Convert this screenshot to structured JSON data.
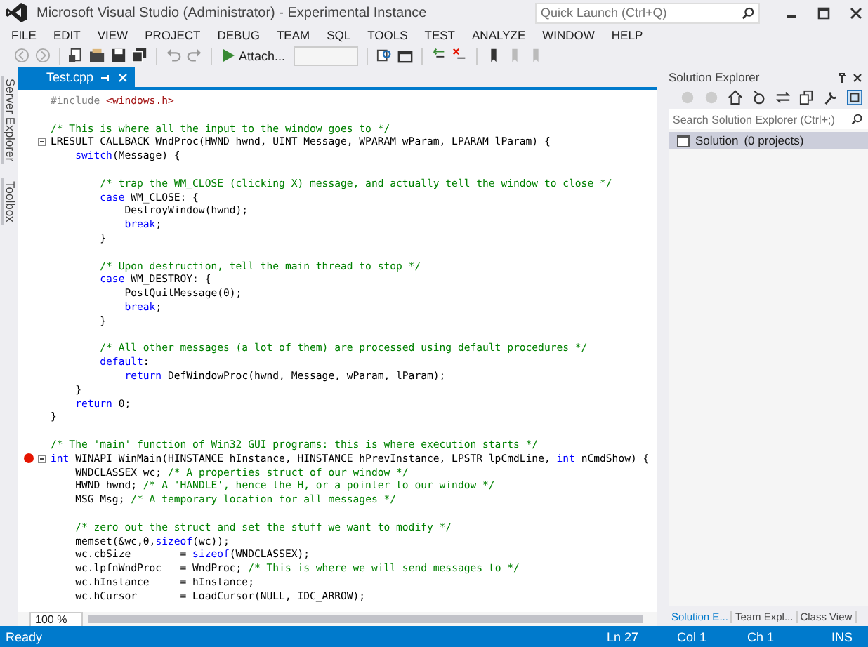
{
  "window": {
    "title": "Microsoft Visual Studio (Administrator) - Experimental Instance"
  },
  "quick_launch": {
    "placeholder": "Quick Launch (Ctrl+Q)"
  },
  "menu": [
    "FILE",
    "EDIT",
    "VIEW",
    "PROJECT",
    "DEBUG",
    "TEAM",
    "SQL",
    "TOOLS",
    "TEST",
    "ANALYZE",
    "WINDOW",
    "HELP"
  ],
  "toolbar": {
    "attach_button": "Attach..."
  },
  "side_tabs": [
    "Server Explorer",
    "Toolbox"
  ],
  "document_tabs": [
    {
      "label": "Test.cpp",
      "selected": true
    }
  ],
  "editor": {
    "zoom": "100 %",
    "lines": [
      {
        "breakpoint": false,
        "fold": false,
        "segments": [
          {
            "kind": "preproc",
            "text": "#include "
          },
          {
            "kind": "string",
            "text": "<windows.h>"
          }
        ]
      },
      {
        "breakpoint": false,
        "fold": false
      },
      {
        "breakpoint": false,
        "fold": false,
        "segments": [
          {
            "kind": "comment",
            "text": "/* This is where all the input to the window goes to */"
          }
        ]
      },
      {
        "breakpoint": false,
        "fold": true,
        "segments": [
          {
            "kind": "plain",
            "text": "LRESULT CALLBACK WndProc(HWND hwnd, UINT Message, WPARAM wParam, LPARAM lParam) {"
          }
        ]
      },
      {
        "breakpoint": false,
        "fold": false,
        "segments": [
          {
            "kind": "keyword",
            "text": "    switch"
          },
          {
            "kind": "plain",
            "text": "(Message) {"
          }
        ]
      },
      {
        "breakpoint": false,
        "fold": false
      },
      {
        "breakpoint": false,
        "fold": false,
        "segments": [
          {
            "kind": "comment",
            "text": "        /* trap the WM_CLOSE (clicking X) message, and actually tell the window to close */"
          }
        ]
      },
      {
        "breakpoint": false,
        "fold": false,
        "segments": [
          {
            "kind": "keyword",
            "text": "        case"
          },
          {
            "kind": "plain",
            "text": " WM_CLOSE: {"
          }
        ]
      },
      {
        "breakpoint": false,
        "fold": false,
        "segments": [
          {
            "kind": "plain",
            "text": "            DestroyWindow(hwnd);"
          }
        ]
      },
      {
        "breakpoint": false,
        "fold": false,
        "segments": [
          {
            "kind": "keyword",
            "text": "            break"
          },
          {
            "kind": "plain",
            "text": ";"
          }
        ]
      },
      {
        "breakpoint": false,
        "fold": false,
        "segments": [
          {
            "kind": "plain",
            "text": "        }"
          }
        ]
      },
      {
        "breakpoint": false,
        "fold": false
      },
      {
        "breakpoint": false,
        "fold": false,
        "segments": [
          {
            "kind": "comment",
            "text": "        /* Upon destruction, tell the main thread to stop */"
          }
        ]
      },
      {
        "breakpoint": false,
        "fold": false,
        "segments": [
          {
            "kind": "keyword",
            "text": "        case"
          },
          {
            "kind": "plain",
            "text": " WM_DESTROY: {"
          }
        ]
      },
      {
        "breakpoint": false,
        "fold": false,
        "segments": [
          {
            "kind": "plain",
            "text": "            PostQuitMessage(0);"
          }
        ]
      },
      {
        "breakpoint": false,
        "fold": false,
        "segments": [
          {
            "kind": "keyword",
            "text": "            break"
          },
          {
            "kind": "plain",
            "text": ";"
          }
        ]
      },
      {
        "breakpoint": false,
        "fold": false,
        "segments": [
          {
            "kind": "plain",
            "text": "        }"
          }
        ]
      },
      {
        "breakpoint": false,
        "fold": false
      },
      {
        "breakpoint": false,
        "fold": false,
        "segments": [
          {
            "kind": "comment",
            "text": "        /* All other messages (a lot of them) are processed using default procedures */"
          }
        ]
      },
      {
        "breakpoint": false,
        "fold": false,
        "segments": [
          {
            "kind": "keyword",
            "text": "        default"
          },
          {
            "kind": "plain",
            "text": ":"
          }
        ]
      },
      {
        "breakpoint": false,
        "fold": false,
        "segments": [
          {
            "kind": "keyword",
            "text": "            return"
          },
          {
            "kind": "plain",
            "text": " DefWindowProc(hwnd, Message, wParam, lParam);"
          }
        ]
      },
      {
        "breakpoint": false,
        "fold": false,
        "segments": [
          {
            "kind": "plain",
            "text": "    }"
          }
        ]
      },
      {
        "breakpoint": false,
        "fold": false,
        "segments": [
          {
            "kind": "keyword",
            "text": "    return"
          },
          {
            "kind": "plain",
            "text": " 0;"
          }
        ]
      },
      {
        "breakpoint": false,
        "fold": false,
        "segments": [
          {
            "kind": "plain",
            "text": "}"
          }
        ]
      },
      {
        "breakpoint": false,
        "fold": false
      },
      {
        "breakpoint": false,
        "fold": false,
        "segments": [
          {
            "kind": "comment",
            "text": "/* The 'main' function of Win32 GUI programs: this is where execution starts */"
          }
        ]
      },
      {
        "breakpoint": true,
        "fold": true,
        "segments": [
          {
            "kind": "keyword",
            "text": "int"
          },
          {
            "kind": "plain",
            "text": " WINAPI WinMain(HINSTANCE hInstance, HINSTANCE hPrevInstance, LPSTR lpCmdLine, "
          },
          {
            "kind": "keyword",
            "text": "int"
          },
          {
            "kind": "plain",
            "text": " nCmdShow) {"
          }
        ]
      },
      {
        "breakpoint": false,
        "fold": false,
        "segments": [
          {
            "kind": "plain",
            "text": "    WNDCLASSEX wc; "
          },
          {
            "kind": "comment",
            "text": "/* A properties struct of our window */"
          }
        ]
      },
      {
        "breakpoint": false,
        "fold": false,
        "segments": [
          {
            "kind": "plain",
            "text": "    HWND hwnd; "
          },
          {
            "kind": "comment",
            "text": "/* A 'HANDLE', hence the H, or a pointer to our window */"
          }
        ]
      },
      {
        "breakpoint": false,
        "fold": false,
        "segments": [
          {
            "kind": "plain",
            "text": "    MSG Msg; "
          },
          {
            "kind": "comment",
            "text": "/* A temporary location for all messages */"
          }
        ]
      },
      {
        "breakpoint": false,
        "fold": false
      },
      {
        "breakpoint": false,
        "fold": false,
        "segments": [
          {
            "kind": "comment",
            "text": "    /* zero out the struct and set the stuff we want to modify */"
          }
        ]
      },
      {
        "breakpoint": false,
        "fold": false,
        "segments": [
          {
            "kind": "plain",
            "text": "    memset(&wc,0,"
          },
          {
            "kind": "keyword",
            "text": "sizeof"
          },
          {
            "kind": "plain",
            "text": "(wc));"
          }
        ]
      },
      {
        "breakpoint": false,
        "fold": false,
        "segments": [
          {
            "kind": "plain",
            "text": "    wc.cbSize        = "
          },
          {
            "kind": "keyword",
            "text": "sizeof"
          },
          {
            "kind": "plain",
            "text": "(WNDCLASSEX);"
          }
        ]
      },
      {
        "breakpoint": false,
        "fold": false,
        "segments": [
          {
            "kind": "plain",
            "text": "    wc.lpfnWndProc   = WndProc; "
          },
          {
            "kind": "comment",
            "text": "/* This is where we will send messages to */"
          }
        ]
      },
      {
        "breakpoint": false,
        "fold": false,
        "segments": [
          {
            "kind": "plain",
            "text": "    wc.hInstance     = hInstance;"
          }
        ]
      },
      {
        "breakpoint": false,
        "fold": false,
        "segments": [
          {
            "kind": "plain",
            "text": "    wc.hCursor       = LoadCursor(NULL, IDC_ARROW);"
          }
        ]
      }
    ]
  },
  "solution_explorer": {
    "title": "Solution Explorer",
    "search": {
      "placeholder": "Search Solution Explorer (Ctrl+;)"
    },
    "items": [
      {
        "label": "Solution",
        "detail": "(0 projects)",
        "selected": true
      }
    ],
    "tabs": [
      {
        "label": "Solution E...",
        "selected": true
      },
      {
        "label": "Team Expl...",
        "selected": false
      },
      {
        "label": "Class View",
        "selected": false
      }
    ]
  },
  "status_bar": {
    "message": "Ready",
    "line": "Ln 27",
    "column": "Col 1",
    "char": "Ch 1",
    "mode": "INS"
  }
}
